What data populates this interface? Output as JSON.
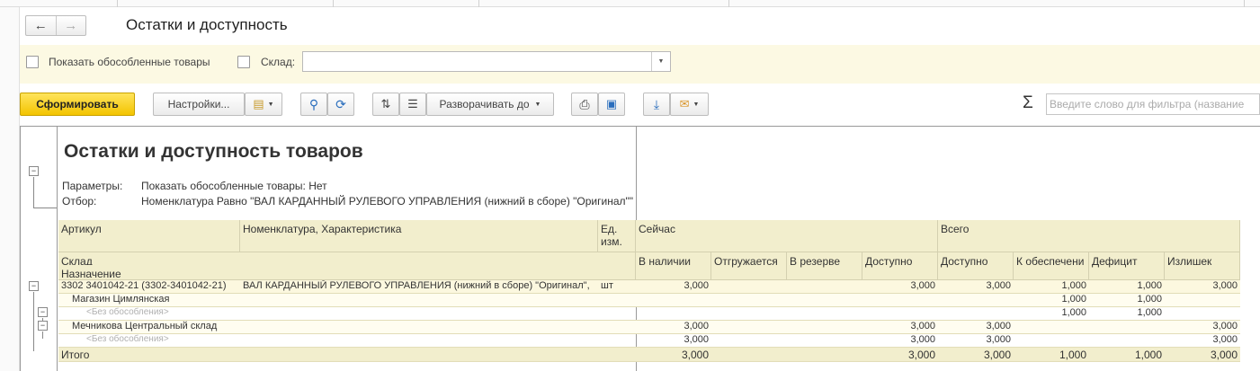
{
  "window": {
    "title": "Остатки и доступность"
  },
  "nav": {
    "back": "←",
    "forward": "→"
  },
  "filters": {
    "show_separated": "Показать обособленные товары",
    "warehouse_label": "Склад:",
    "warehouse_value": ""
  },
  "toolbar": {
    "generate": "Сформировать",
    "settings": "Настройки...",
    "expand": "Разворачивать до",
    "search_placeholder": "Введите слово для фильтра (название"
  },
  "report": {
    "title": "Остатки и доступность товаров",
    "params_label": "Параметры:",
    "params_value": "Показать обособленные товары: Нет",
    "filter_label": "Отбор:",
    "filter_value": "Номенклатура Равно \"ВАЛ КАРДАННЫЙ РУЛЕВОГО УПРАВЛЕНИЯ (нижний в сборе) \"Оригинал\"\"",
    "headers": {
      "article": "Артикул",
      "nomenclature": "Номенклатура, Характеристика",
      "unit": "Ед. изм.",
      "now": "Сейчас",
      "total": "Всего",
      "warehouse": "Склад",
      "purpose": "Назначение",
      "in_stock": "В наличии",
      "shipping": "Отгружается",
      "reserved": "В резерве",
      "available": "Доступно",
      "available_total": "Доступно",
      "to_provide": "К обеспечени",
      "deficit": "Дефицит",
      "surplus": "Излишек"
    },
    "item": {
      "article": "3302 3401042-21  (3302-3401042-21)",
      "name": "ВАЛ КАРДАННЫЙ РУЛЕВОГО УПРАВЛЕНИЯ (нижний в сборе) \"Оригинал\",",
      "unit": "шт",
      "in_stock": "3,000",
      "available": "3,000",
      "available_total": "3,000",
      "to_provide": "1,000",
      "deficit": "1,000",
      "surplus": "3,000"
    },
    "rows": [
      {
        "name": "Магазин Цимлянская",
        "to_provide": "1,000",
        "deficit": "1,000"
      },
      {
        "name": "<Без обособления>",
        "to_provide": "1,000",
        "deficit": "1,000"
      },
      {
        "name": "Мечникова Центральный склад",
        "in_stock": "3,000",
        "available": "3,000",
        "available_total": "3,000",
        "surplus": "3,000"
      },
      {
        "name": "<Без обособления>",
        "in_stock": "3,000",
        "available": "3,000",
        "available_total": "3,000",
        "surplus": "3,000"
      }
    ],
    "total": {
      "label": "Итого",
      "in_stock": "3,000",
      "available": "3,000",
      "available_total": "3,000",
      "to_provide": "1,000",
      "deficit": "1,000",
      "surplus": "3,000"
    }
  }
}
